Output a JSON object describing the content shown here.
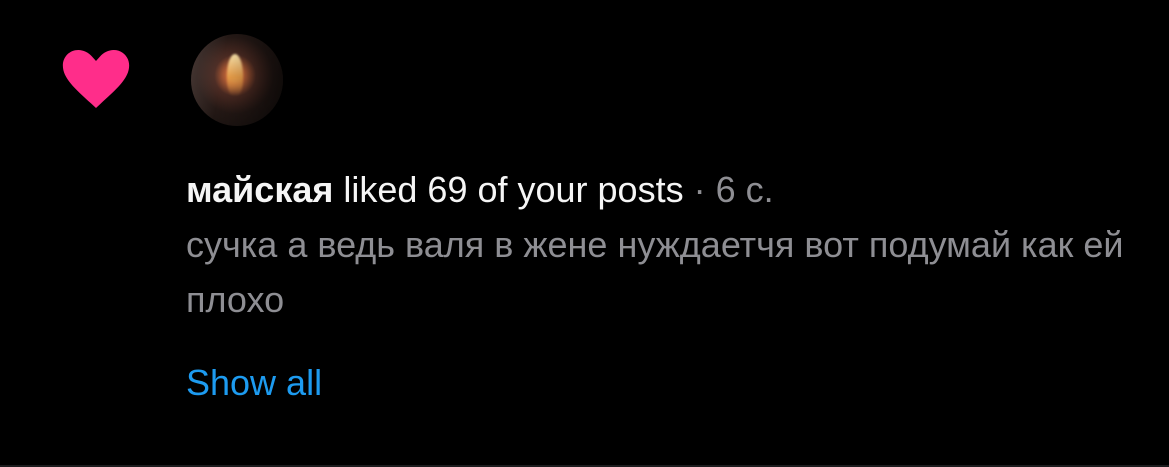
{
  "notification": {
    "username": "майская",
    "action": " liked 69 of your posts",
    "separator": " · ",
    "time": "6 с.",
    "comment": "сучка а ведь валя в жене нуждаетчя вот подумай как ей плохо",
    "show_all_label": "Show all"
  },
  "icons": {
    "like": "heart-icon",
    "avatar": "user-avatar"
  },
  "colors": {
    "background": "#000000",
    "heart": "#ff2d8a",
    "username": "#f5f5f5",
    "secondary_text": "#8e8e93",
    "link": "#1d9bf0"
  }
}
